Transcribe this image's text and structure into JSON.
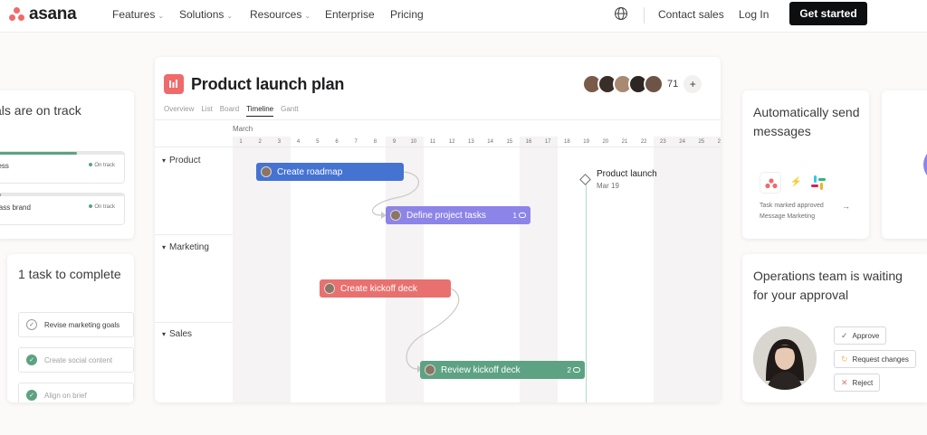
{
  "nav": {
    "logo_text": "asana",
    "items": [
      {
        "label": "Features",
        "has_dropdown": true
      },
      {
        "label": "Solutions",
        "has_dropdown": true
      },
      {
        "label": "Resources",
        "has_dropdown": true
      },
      {
        "label": "Enterprise",
        "has_dropdown": false
      },
      {
        "label": "Pricing",
        "has_dropdown": false
      }
    ],
    "globe_icon": "globe-icon",
    "contact_sales": "Contact sales",
    "log_in": "Log In",
    "get_started": "Get started",
    "colors": {
      "brand": "#f06a6a",
      "cta_bg": "#0d0e10"
    }
  },
  "goals_card": {
    "title": "als are on track",
    "goals": [
      {
        "name": "ness",
        "status": "On track",
        "progress": 0.65
      },
      {
        "name": "class brand",
        "status": "On track",
        "progress": 0.08
      }
    ]
  },
  "tasks_card": {
    "title": "1 task to complete",
    "tasks": [
      {
        "text": "Revise marketing goals",
        "done": false
      },
      {
        "text": "Create social content",
        "done": true
      },
      {
        "text": "Align on brief",
        "done": true
      }
    ]
  },
  "project": {
    "title": "Product launch plan",
    "member_count": "71",
    "add_label": "+",
    "tabs": [
      "Overview",
      "List",
      "Board",
      "Timeline",
      "Gantt"
    ],
    "active_tab": "Timeline",
    "month": "March",
    "days": [
      "1",
      "2",
      "3",
      "4",
      "5",
      "6",
      "7",
      "8",
      "9",
      "10",
      "11",
      "12",
      "13",
      "14",
      "15",
      "16",
      "17",
      "18",
      "19",
      "20",
      "21",
      "22",
      "23",
      "24",
      "25",
      "26",
      "2"
    ],
    "sections": [
      "Product",
      "Marketing",
      "Sales"
    ],
    "tasks": [
      {
        "label": "Create roadmap",
        "color": "#4573d2",
        "comments": ""
      },
      {
        "label": "Define project tasks",
        "color": "#8d84e8",
        "comments": "1"
      },
      {
        "label": "Create kickoff deck",
        "color": "#e8716f",
        "comments": ""
      },
      {
        "label": "Review kickoff deck",
        "color": "#5da283",
        "comments": "2"
      }
    ],
    "milestone": {
      "title": "Product launch",
      "date": "Mar 19"
    }
  },
  "automation_card": {
    "title": "Automatically send messages",
    "line1": "Task marked approved",
    "line2": "Message Marketing",
    "arrow": "→"
  },
  "approval_card": {
    "title": "Operations team is waiting for your approval",
    "actions": [
      {
        "label": "Approve",
        "icon": "check-icon",
        "icon_glyph": "✓",
        "icon_color": "#6d6e6f"
      },
      {
        "label": "Request changes",
        "icon": "refresh-icon",
        "icon_glyph": "↻",
        "icon_color": "#f1bd6c"
      },
      {
        "label": "Reject",
        "icon": "close-icon",
        "icon_glyph": "✕",
        "icon_color": "#e8716f"
      }
    ]
  }
}
